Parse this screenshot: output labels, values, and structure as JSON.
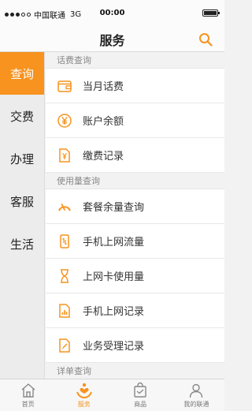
{
  "status_bar": {
    "carrier": "中国联通",
    "network": "3G",
    "time": "00:00"
  },
  "header": {
    "title": "服务"
  },
  "sidebar": {
    "items": [
      {
        "label": "查询",
        "active": true
      },
      {
        "label": "交费",
        "active": false
      },
      {
        "label": "办理",
        "active": false
      },
      {
        "label": "客服",
        "active": false
      },
      {
        "label": "生活",
        "active": false
      }
    ]
  },
  "sections": [
    {
      "title": "话费查询",
      "items": [
        {
          "label": "当月话费",
          "icon": "wallet-icon"
        },
        {
          "label": "账户余额",
          "icon": "yen-icon"
        },
        {
          "label": "缴费记录",
          "icon": "yen-document-icon"
        }
      ]
    },
    {
      "title": "使用量查询",
      "items": [
        {
          "label": "套餐余量查询",
          "icon": "gauge-icon"
        },
        {
          "label": "手机上网流量",
          "icon": "phone-data-icon"
        },
        {
          "label": "上网卡使用量",
          "icon": "hourglass-icon"
        },
        {
          "label": "手机上网记录",
          "icon": "bar-document-icon"
        },
        {
          "label": "业务受理记录",
          "icon": "pen-document-icon"
        }
      ]
    },
    {
      "title": "详单查询",
      "items": []
    }
  ],
  "tab_bar": {
    "tabs": [
      {
        "label": "首页",
        "icon": "home-icon",
        "active": false
      },
      {
        "label": "服务",
        "icon": "service-hand-icon",
        "active": true
      },
      {
        "label": "商品",
        "icon": "shopping-bag-icon",
        "active": false
      },
      {
        "label": "我的联通",
        "icon": "user-icon",
        "active": false
      }
    ]
  },
  "colors": {
    "accent": "#f7931e",
    "rail_bg": "#ececec",
    "section_bg": "#f2f2f2"
  }
}
